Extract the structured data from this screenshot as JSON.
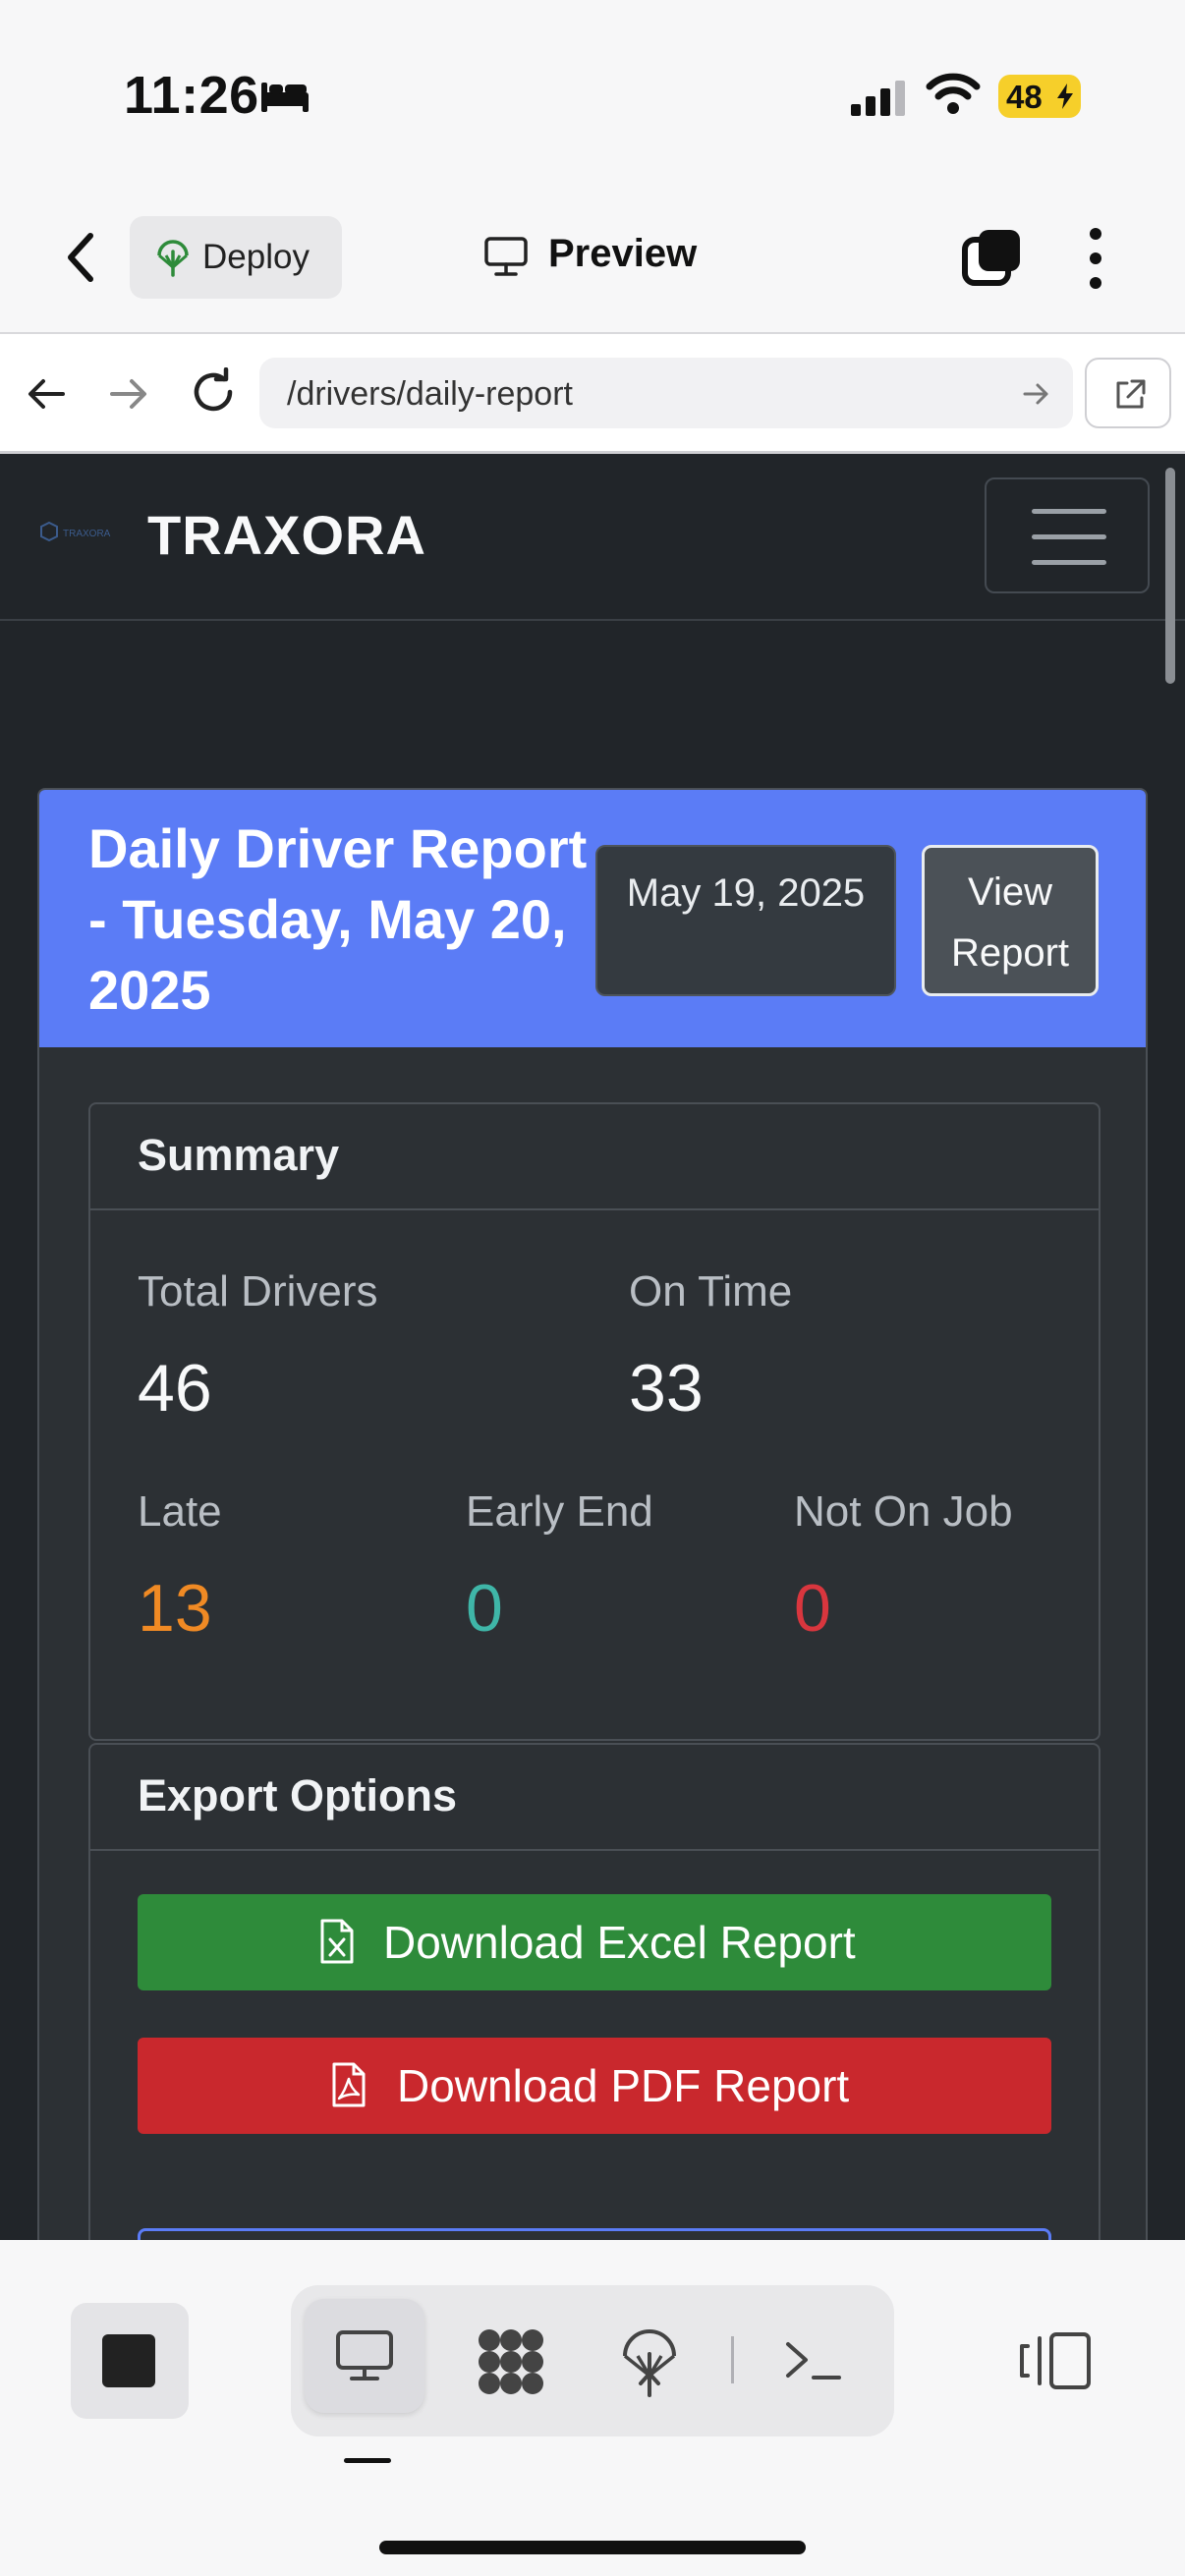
{
  "status_bar": {
    "time": "11:26",
    "battery": "48"
  },
  "header": {
    "deploy_label": "Deploy",
    "preview_label": "Preview"
  },
  "browser": {
    "url": "/drivers/daily-report"
  },
  "site": {
    "brand": "TRAXORA",
    "logo_text": "TRAXORA"
  },
  "report": {
    "title": "Daily Driver Report - Tuesday, May 20, 2025",
    "date_button": "May 19, 2025",
    "view_button": "View Report"
  },
  "summary": {
    "title": "Summary",
    "total_drivers_label": "Total Drivers",
    "total_drivers": "46",
    "on_time_label": "On Time",
    "on_time": "33",
    "late_label": "Late",
    "late": "13",
    "early_end_label": "Early End",
    "early_end": "0",
    "not_on_job_label": "Not On Job",
    "not_on_job": "0"
  },
  "export": {
    "title": "Export Options",
    "excel_label": "Download Excel Report",
    "pdf_label": "Download PDF Report"
  },
  "colors": {
    "accent": "#5b7cf6",
    "late": "#f08a24",
    "early_end": "#3fb6a8",
    "not_on_job": "#d9363e",
    "excel": "#2e8b3a",
    "pdf": "#c9282d"
  },
  "toolbar": {
    "icons": [
      "stop-icon",
      "desktop-icon",
      "workflow-icon",
      "deploy-icon",
      "terminal-icon",
      "panel-toggle-icon"
    ]
  }
}
